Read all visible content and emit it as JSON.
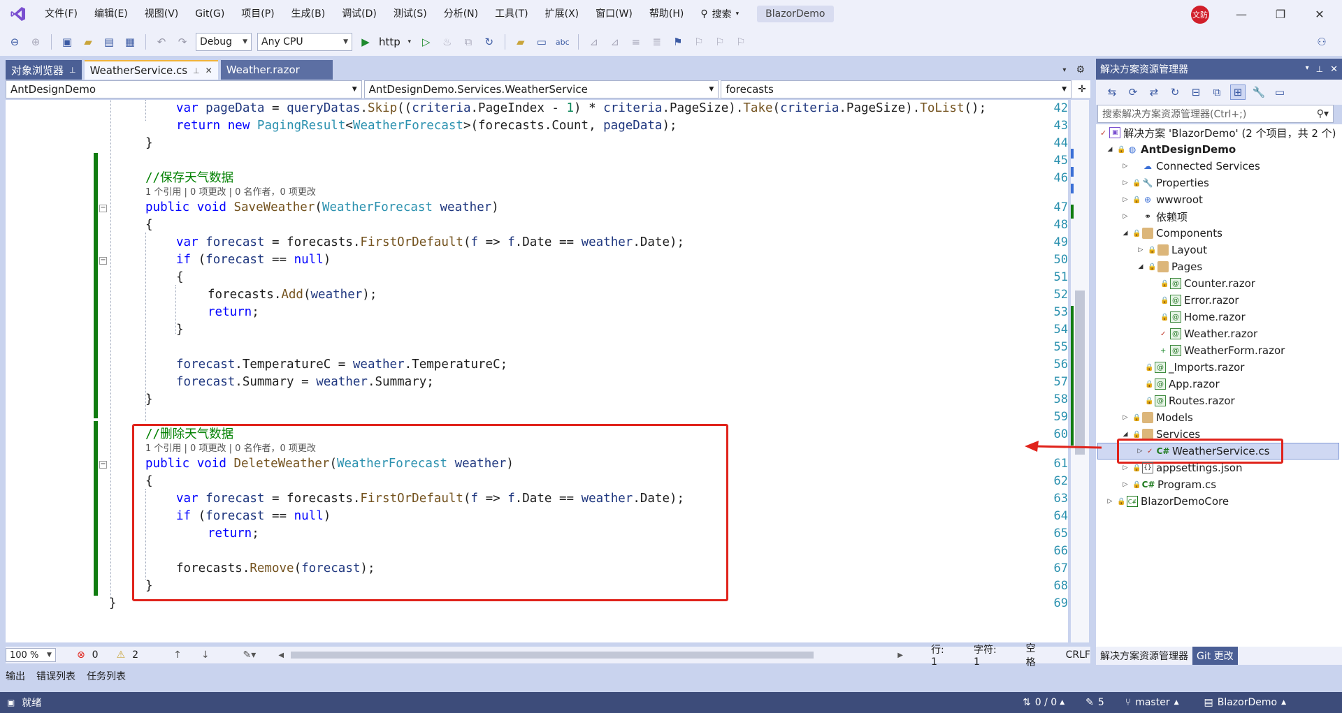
{
  "titlebar": {
    "menus": [
      "文件(F)",
      "编辑(E)",
      "视图(V)",
      "Git(G)",
      "项目(P)",
      "生成(B)",
      "调试(D)",
      "测试(S)",
      "分析(N)",
      "工具(T)",
      "扩展(X)",
      "窗口(W)",
      "帮助(H)"
    ],
    "search_label": "搜索",
    "solution_name": "BlazorDemo",
    "user_initials": "文防"
  },
  "toolbar": {
    "config": "Debug",
    "platform": "Any CPU",
    "run_target": "http"
  },
  "tabs": {
    "object_browser": "对象浏览器",
    "active": "WeatherService.cs",
    "other": "Weather.razor"
  },
  "navbar": {
    "project": "AntDesignDemo",
    "type": "AntDesignDemo.Services.WeatherService",
    "member": "forecasts"
  },
  "editor": {
    "line_numbers": [
      "42",
      "43",
      "44",
      "45",
      "46",
      "47",
      "48",
      "49",
      "50",
      "51",
      "52",
      "53",
      "54",
      "55",
      "56",
      "57",
      "58",
      "59",
      "60",
      "61",
      "62",
      "63",
      "64",
      "65",
      "66",
      "67",
      "68",
      "69"
    ],
    "codelens": "1 个引用 | 0 项更改 | 0 名作者，0 项更改",
    "comment_save": "//保存天气数据",
    "comment_delete": "//删除天气数据"
  },
  "editor_status": {
    "zoom": "100 %",
    "errors": "0",
    "warnings": "2",
    "line": "行: 1",
    "char": "字符: 1",
    "spaces": "空格",
    "eol": "CRLF"
  },
  "bottom_tabs": [
    "输出",
    "错误列表",
    "任务列表"
  ],
  "statusbar": {
    "ready": "就绪",
    "sync": "0 / 0",
    "pending": "5",
    "branch": "master",
    "repo": "BlazorDemo"
  },
  "solution_explorer": {
    "title": "解决方案资源管理器",
    "search_placeholder": "搜索解决方案资源管理器(Ctrl+;)",
    "solution_line": "解决方案 'BlazorDemo' (2 个项目，共 2 个)",
    "items": [
      {
        "label": "AntDesignDemo",
        "bold": true
      },
      {
        "label": "Connected Services"
      },
      {
        "label": "Properties"
      },
      {
        "label": "wwwroot"
      },
      {
        "label": "依赖项"
      },
      {
        "label": "Components"
      },
      {
        "label": "Layout"
      },
      {
        "label": "Pages"
      },
      {
        "label": "Counter.razor"
      },
      {
        "label": "Error.razor"
      },
      {
        "label": "Home.razor"
      },
      {
        "label": "Weather.razor"
      },
      {
        "label": "WeatherForm.razor"
      },
      {
        "label": "_Imports.razor"
      },
      {
        "label": "App.razor"
      },
      {
        "label": "Routes.razor"
      },
      {
        "label": "Models"
      },
      {
        "label": "Services"
      },
      {
        "label": "WeatherService.cs"
      },
      {
        "label": "appsettings.json"
      },
      {
        "label": "Program.cs"
      },
      {
        "label": "BlazorDemoCore"
      }
    ],
    "bottom_tab_active": "解决方案资源管理器",
    "bottom_tab_other": "Git 更改"
  }
}
